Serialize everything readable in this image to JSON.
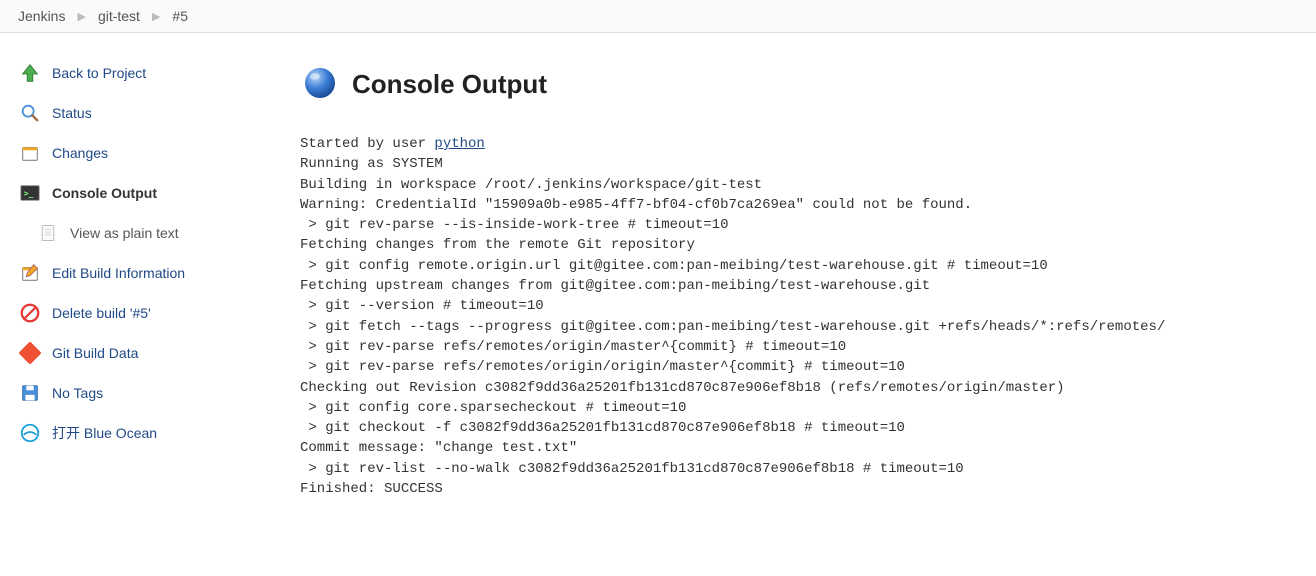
{
  "breadcrumb": {
    "items": [
      {
        "label": "Jenkins"
      },
      {
        "label": "git-test"
      },
      {
        "label": "#5"
      }
    ]
  },
  "sidebar": {
    "items": [
      {
        "key": "back",
        "label": "Back to Project"
      },
      {
        "key": "status",
        "label": "Status"
      },
      {
        "key": "changes",
        "label": "Changes"
      },
      {
        "key": "console",
        "label": "Console Output",
        "active": true
      },
      {
        "key": "plaintext",
        "label": "View as plain text",
        "sub": true
      },
      {
        "key": "edit",
        "label": "Edit Build Information"
      },
      {
        "key": "delete",
        "label": "Delete build '#5'"
      },
      {
        "key": "gitdata",
        "label": "Git Build Data"
      },
      {
        "key": "notags",
        "label": "No Tags"
      },
      {
        "key": "blueocean",
        "label": "打开 Blue Ocean"
      }
    ]
  },
  "page": {
    "title": "Console Output"
  },
  "console": {
    "started_prefix": "Started by user ",
    "started_user": "python",
    "lines": [
      "Running as SYSTEM",
      "Building in workspace /root/.jenkins/workspace/git-test",
      "Warning: CredentialId \"15909a0b-e985-4ff7-bf04-cf0b7ca269ea\" could not be found.",
      " > git rev-parse --is-inside-work-tree # timeout=10",
      "Fetching changes from the remote Git repository",
      " > git config remote.origin.url git@gitee.com:pan-meibing/test-warehouse.git # timeout=10",
      "Fetching upstream changes from git@gitee.com:pan-meibing/test-warehouse.git",
      " > git --version # timeout=10",
      " > git fetch --tags --progress git@gitee.com:pan-meibing/test-warehouse.git +refs/heads/*:refs/remotes/",
      " > git rev-parse refs/remotes/origin/master^{commit} # timeout=10",
      " > git rev-parse refs/remotes/origin/origin/master^{commit} # timeout=10",
      "Checking out Revision c3082f9dd36a25201fb131cd870c87e906ef8b18 (refs/remotes/origin/master)",
      " > git config core.sparsecheckout # timeout=10",
      " > git checkout -f c3082f9dd36a25201fb131cd870c87e906ef8b18 # timeout=10",
      "Commit message: \"change test.txt\"",
      " > git rev-list --no-walk c3082f9dd36a25201fb131cd870c87e906ef8b18 # timeout=10",
      "Finished: SUCCESS"
    ]
  }
}
